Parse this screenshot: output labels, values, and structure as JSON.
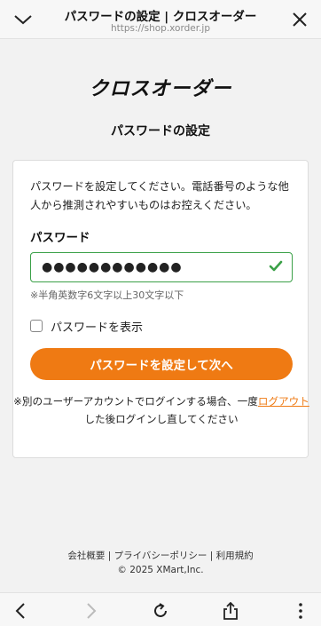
{
  "browser": {
    "page_title": "パスワードの設定 | クロスオーダー",
    "url": "https://shop.xorder.jp"
  },
  "brand": {
    "logo_text": "クロスオーダー"
  },
  "page": {
    "heading": "パスワードの設定"
  },
  "form": {
    "description": "パスワードを設定してください。電話番号のような他人から推測されやすいものはお控えください。",
    "password_label": "パスワード",
    "password_value": "●●●●●●●●●●●●",
    "hint": "※半角英数字6文字以上30文字以下",
    "show_password_label": "パスワードを表示",
    "submit_label": "パスワードを設定して次へ",
    "note_prefix": "※別のユーザーアカウントでログインする場合、一度",
    "note_link": "ログアウト",
    "note_suffix": "した後ログインし直してください"
  },
  "footer": {
    "links": "会社概要 | プライバシーポリシー | 利用規約",
    "copyright": "© 2025 XMart,Inc."
  },
  "colors": {
    "accent": "#ef7a13",
    "valid": "#3aa047"
  },
  "icons": {
    "top_left": "chevron-down-icon",
    "top_right": "close-icon",
    "toolbar": [
      "back-icon",
      "forward-icon",
      "reload-icon",
      "share-icon",
      "more-icon"
    ]
  }
}
